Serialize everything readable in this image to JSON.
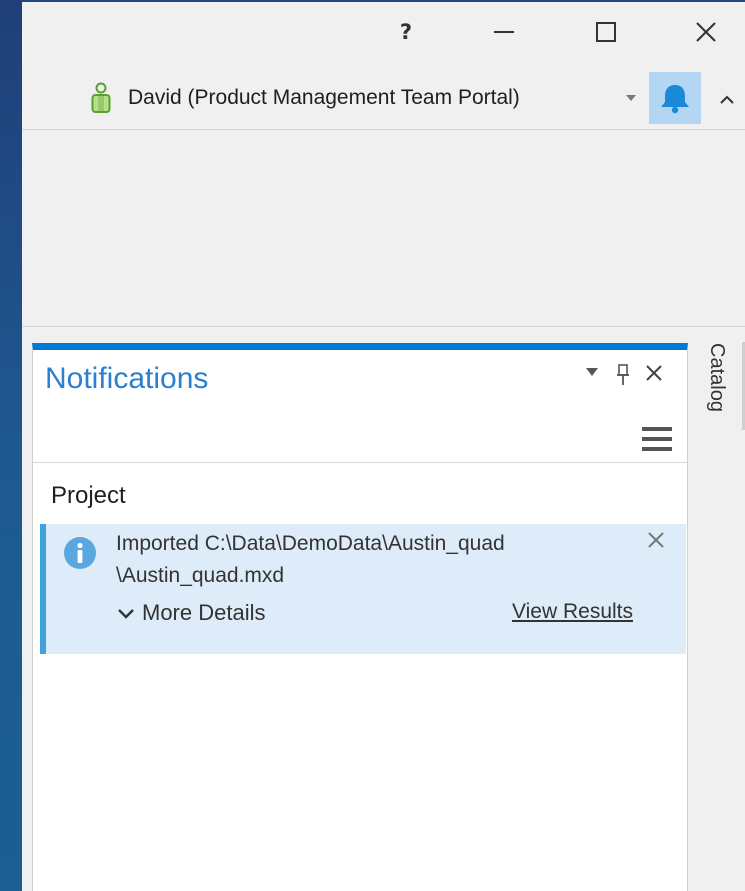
{
  "window": {
    "help_label": "?",
    "minimize_icon": "minimize-icon",
    "maximize_icon": "maximize-icon",
    "close_icon": "close-icon"
  },
  "userbar": {
    "user_name": "David (Product Management Team Portal)",
    "user_icon": "user-icon",
    "dropdown_icon": "caret-down-icon",
    "bell_icon": "notification-bell-icon",
    "collapse_icon": "chevron-up-icon"
  },
  "notifications": {
    "title": "Notifications",
    "group": "Project",
    "item": {
      "message": "Imported C:\\Data\\DemoData\\Austin_quad\n\\Austin_quad.mxd",
      "more_details": "More Details",
      "view_results": "View Results"
    }
  },
  "catalog_tab": {
    "label": "Catalog"
  },
  "colors": {
    "accent_blue": "#0078d4",
    "title_blue": "#2a7fd1",
    "item_bg": "#ddecf8",
    "item_border": "#3fa2df",
    "bell_bg": "#b4d6f2",
    "desktop_bg": "#1e4a80"
  }
}
